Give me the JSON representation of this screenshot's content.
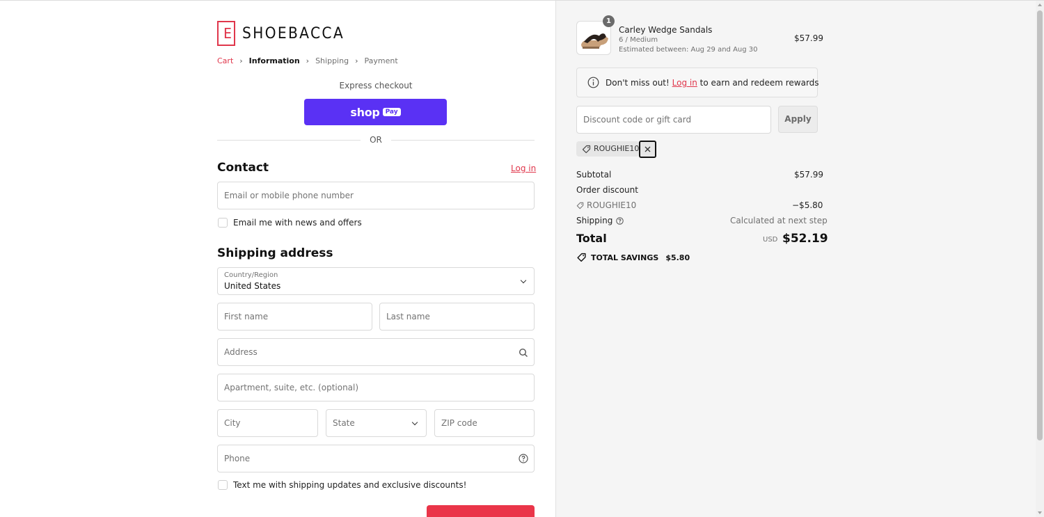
{
  "brand": {
    "name": "SHOEBACCA",
    "logo_mark": "E",
    "accent": "#e0364b"
  },
  "breadcrumb": {
    "items": [
      {
        "label": "Cart",
        "state": "link"
      },
      {
        "label": "Information",
        "state": "current"
      },
      {
        "label": "Shipping",
        "state": "inactive"
      },
      {
        "label": "Payment",
        "state": "inactive"
      }
    ],
    "separator": "›"
  },
  "express": {
    "label": "Express checkout",
    "shoppay_text": "shop",
    "shoppay_badge": "Pay",
    "shoppay_color": "#5a31f4"
  },
  "divider": {
    "label": "OR"
  },
  "contact": {
    "title": "Contact",
    "login_label": "Log in",
    "email_placeholder": "Email or mobile phone number",
    "newsletter_label": "Email me with news and offers"
  },
  "shipping": {
    "title": "Shipping address",
    "country_label": "Country/Region",
    "country_value": "United States",
    "first_name_placeholder": "First name",
    "last_name_placeholder": "Last name",
    "address_placeholder": "Address",
    "apartment_placeholder": "Apartment, suite, etc. (optional)",
    "city_placeholder": "City",
    "state_placeholder": "State",
    "zip_placeholder": "ZIP code",
    "phone_placeholder": "Phone",
    "sms_label": "Text me with shipping updates and exclusive discounts!"
  },
  "summary": {
    "item": {
      "name": "Carley Wedge Sandals",
      "variant": "6 / Medium",
      "eta": "Estimated between: Aug 29 and Aug 30",
      "price": "$57.99",
      "quantity": "1"
    },
    "rewards": {
      "prefix": "Don't miss out!",
      "link": "Log in",
      "suffix": "to earn and redeem rewards"
    },
    "discount": {
      "placeholder": "Discount code or gift card",
      "apply_label": "Apply",
      "applied_code": "ROUGHIE10"
    },
    "subtotal_label": "Subtotal",
    "subtotal_value": "$57.99",
    "order_discount_label": "Order discount",
    "discount_code": "ROUGHIE10",
    "discount_value": "−$5.80",
    "shipping_label": "Shipping",
    "shipping_value": "Calculated at next step",
    "total_label": "Total",
    "currency": "USD",
    "total_value": "$52.19",
    "savings_label": "TOTAL SAVINGS",
    "savings_value": "$5.80"
  }
}
